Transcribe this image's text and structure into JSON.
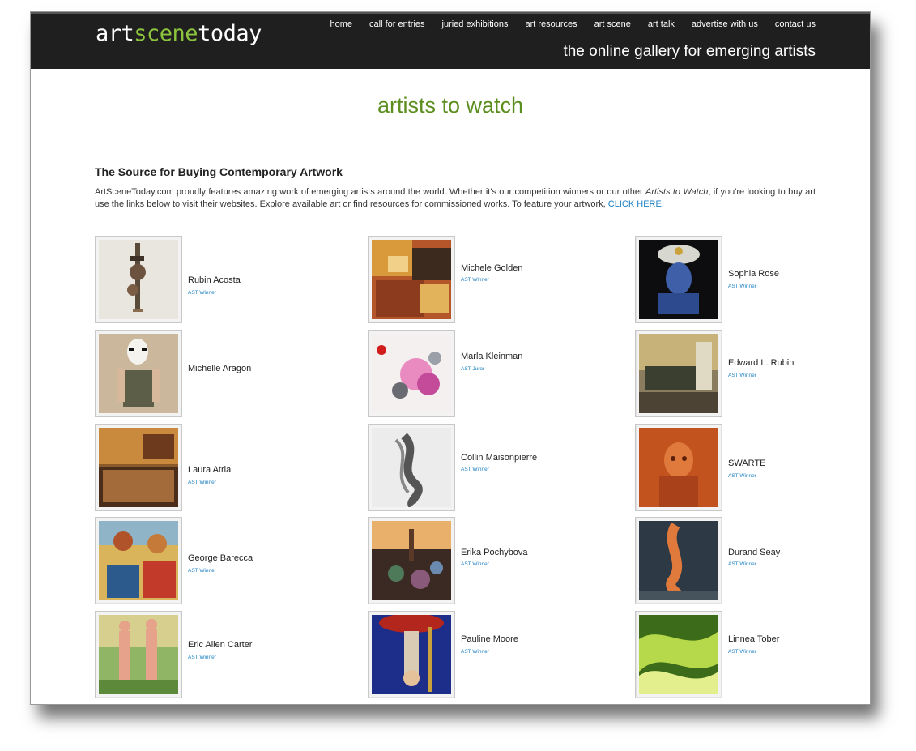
{
  "header": {
    "logo": {
      "part1": "art",
      "part2": "scene",
      "part3": "today"
    },
    "nav": [
      "home",
      "call for entries",
      "juried exhibitions",
      "art resources",
      "art scene",
      "art talk",
      "advertise with us",
      "contact us"
    ],
    "tagline": "the online gallery for emerging artists"
  },
  "page_title": "artists to watch",
  "section_heading": "The Source for Buying Contemporary Artwork",
  "intro": {
    "text_before": "ArtSceneToday.com proudly features amazing work of emerging artists around the world. Whether it's our competition winners or our other ",
    "italic": "Artists to Watch",
    "text_after": ", if you're looking to buy art use the links below to visit their websites.  Explore available art or find resources for commissioned works.  To feature your artwork, ",
    "link": "CLICK HERE."
  },
  "artists": [
    {
      "name": "Rubin Acosta",
      "badge": "AST Winner"
    },
    {
      "name": "Michele Golden",
      "badge": "AST Winner"
    },
    {
      "name": "Sophia Rose",
      "badge": "AST Winner"
    },
    {
      "name": "Michelle Aragon",
      "badge": ""
    },
    {
      "name": "Marla Kleinman",
      "badge": "AST Juror"
    },
    {
      "name": "Edward L. Rubin",
      "badge": "AST Winner"
    },
    {
      "name": "Laura Atria",
      "badge": "AST Winner"
    },
    {
      "name": "Collin Maisonpierre",
      "badge": "AST Winner"
    },
    {
      "name": "SWARTE",
      "badge": "AST Winner"
    },
    {
      "name": "George Barecca",
      "badge": "AST Winne"
    },
    {
      "name": "Erika Pochybova",
      "badge": "AST Winner"
    },
    {
      "name": "Durand Seay",
      "badge": "AST Winner"
    },
    {
      "name": "Eric Allen Carter",
      "badge": "AST Winner"
    },
    {
      "name": "Pauline Moore",
      "badge": "AST Winner"
    },
    {
      "name": "Linnea Tober",
      "badge": "AST Winner"
    }
  ],
  "colors": {
    "header_bg": "#1f1f1f",
    "logo_accent": "#8cc43e",
    "title_green": "#5c8e1f",
    "link_blue": "#1a7fc4"
  }
}
